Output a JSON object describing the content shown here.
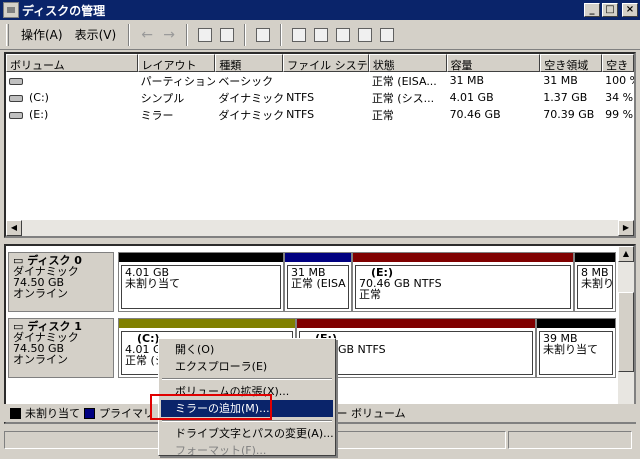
{
  "window": {
    "title": "ディスクの管理"
  },
  "titlebar_buttons": {
    "minimize": "_",
    "maximize": "□",
    "close": "×"
  },
  "menu": {
    "action": "操作(A)",
    "view": "表示(V)"
  },
  "toolbar": {
    "back": "←",
    "forward": "→"
  },
  "columns": [
    "ボリューム",
    "レイアウト",
    "種類",
    "ファイル システ...",
    "状態",
    "容量",
    "空き領域",
    "空き"
  ],
  "volumes": [
    {
      "name": "",
      "layout": "パーティション",
      "type": "ベーシック",
      "fs": "",
      "status": "正常 (EISA...",
      "capacity": "31 MB",
      "free": "31 MB",
      "pct": "100 %"
    },
    {
      "name": "(C:)",
      "layout": "シンプル",
      "type": "ダイナミック",
      "fs": "NTFS",
      "status": "正常 (シス...",
      "capacity": "4.01 GB",
      "free": "1.37 GB",
      "pct": "34 %"
    },
    {
      "name": "(E:)",
      "layout": "ミラー",
      "type": "ダイナミック",
      "fs": "NTFS",
      "status": "正常",
      "capacity": "70.46 GB",
      "free": "70.39 GB",
      "pct": "99 %"
    }
  ],
  "disks": [
    {
      "name": "ディスク 0",
      "type": "ダイナミック",
      "size": "74.50 GB",
      "state": "オンライン",
      "partitions": [
        {
          "label": "",
          "line1": "4.01 GB",
          "line2": "未割り当て"
        },
        {
          "label": "",
          "line1": "31 MB",
          "line2": "正常 (EISA"
        },
        {
          "label": "(E:)",
          "line1": "70.46 GB NTFS",
          "line2": "正常"
        },
        {
          "label": "",
          "line1": "8 MB",
          "line2": "未割り"
        }
      ]
    },
    {
      "name": "ディスク 1",
      "type": "ダイナミック",
      "size": "74.50 GB",
      "state": "オンライン",
      "partitions": [
        {
          "label": "(C:)",
          "line1": "4.01 GB",
          "line2": "正常 (シ"
        },
        {
          "label": "(E:)",
          "line1": "70.46 GB NTFS",
          "line2": ""
        },
        {
          "label": "",
          "line1": "39 MB",
          "line2": "未割り当て"
        }
      ]
    }
  ],
  "legend": {
    "unallocated": "未割り当て",
    "primary": "プライマリ パ",
    "mirror": "ミラー ボリューム"
  },
  "context_menu": {
    "open": "開く(O)",
    "explore": "エクスプローラ(E)",
    "extend": "ボリュームの拡張(X)...",
    "add_mirror": "ミラーの追加(M)...",
    "change_letter": "ドライブ文字とパスの変更(A)...",
    "format": "フォーマット(F)..."
  },
  "colors": {
    "unallocated": "#000000",
    "primary": "#000080",
    "mirror": "#800000",
    "simple": "#808000",
    "selection": "#0a246a",
    "highlight": "#e00000"
  }
}
